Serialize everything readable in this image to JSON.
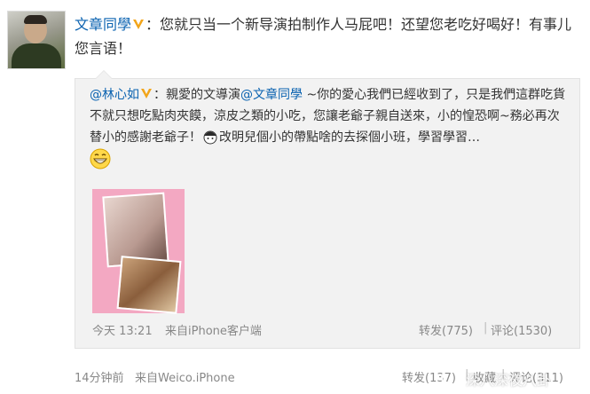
{
  "post": {
    "author": "文章同學",
    "text": "：您就只当一个新导演拍制作人马屁吧！还望您老吃好喝好！有事儿您言语！"
  },
  "repost": {
    "author": "@林心如",
    "text_1": "：親愛的文導演",
    "mention": "@文章同學",
    "text_2": " ~你的愛心我們已經收到了，只是我們這群吃貨不就只想吃點肉夾饃，涼皮之類的小吃，您讓老爺子親自送來，小的惶恐啊~務必再次替小的感謝老爺子！",
    "text_3": "改明兒個小的帶點啥的去探個小班，學習學習…",
    "time": "今天 13:21",
    "source": "来自iPhone客户端",
    "forward": "转发(775)",
    "comment": "评论(1530)"
  },
  "footer": {
    "time": "14分钟前",
    "source": "来自Weico.iPhone",
    "forward": "转发(137)",
    "favorite": "收藏",
    "comment": "评论(311)"
  },
  "watermark": {
    "text": "深八深夜八卦"
  },
  "colors": {
    "link": "#0a62b0",
    "badge": "#f2a51a",
    "repost_bg": "#f2f2f2",
    "photo_bg": "#f3a8c2"
  },
  "icons": [
    "verified-v-badge-icon",
    "grin-emoji-icon",
    "cartoon-face-icon",
    "wechat-logo-icon"
  ]
}
